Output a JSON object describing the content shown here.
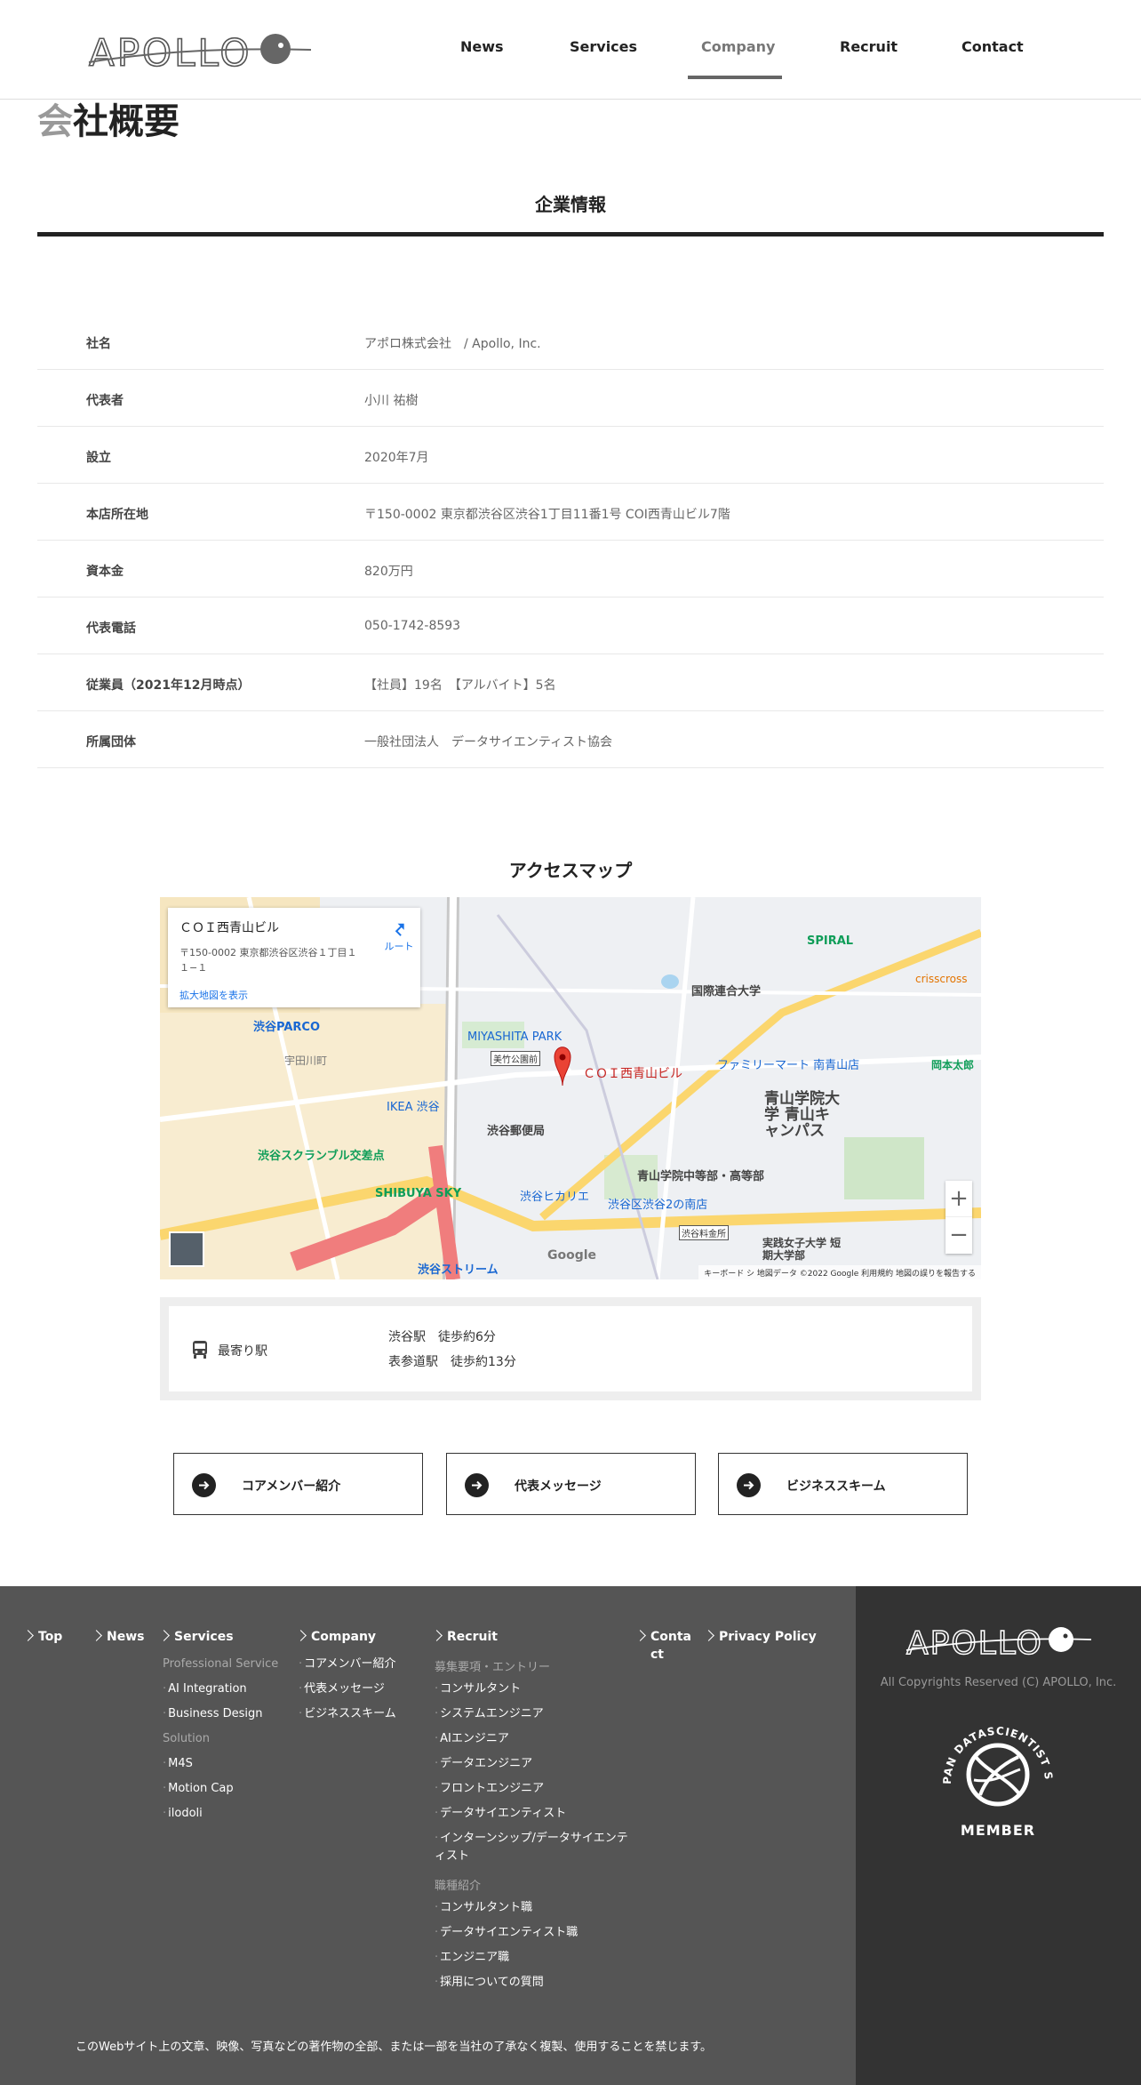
{
  "header": {
    "logo_text": "APOLLO",
    "nav": [
      {
        "label": "News"
      },
      {
        "label": "Services"
      },
      {
        "label": "Company",
        "active": true
      },
      {
        "label": "Recruit"
      },
      {
        "label": "Contact"
      }
    ]
  },
  "page_title": {
    "first_char": "会",
    "rest": "社概要"
  },
  "company_info": {
    "title": "企業情報",
    "rows": [
      {
        "label": "社名",
        "value": "アポロ株式会社　/ Apollo, Inc."
      },
      {
        "label": "代表者",
        "value": "小川 祐樹"
      },
      {
        "label": "設立",
        "value": "2020年7月"
      },
      {
        "label": "本店所在地",
        "value": "〒150-0002 東京都渋谷区渋谷1丁目11番1号 COI西青山ビル7階"
      },
      {
        "label": "資本金",
        "value": "820万円"
      },
      {
        "label": "代表電話",
        "value": "050-1742-8593"
      },
      {
        "label": "従業員（2021年12月時点）",
        "value": "【社員】19名　【アルバイト】5名"
      },
      {
        "label": "所属団体",
        "value": "一般社団法人　データサイエンティスト協会"
      }
    ]
  },
  "access": {
    "title": "アクセスマップ",
    "map": {
      "place_name": "ＣＯＩ西青山ビル",
      "place_address": "〒150-0002 東京都渋谷区渋谷１丁目１１−１",
      "route_label": "ルート",
      "enlarge_label": "拡大地図を表示",
      "pin_label": "ＣＯＩ西青山ビル",
      "zoom_in": "+",
      "zoom_out": "−",
      "google": "Google",
      "footer": "キーボード シ  地図データ ©2022 Google   利用規約   地図の誤りを報告する",
      "labels": [
        {
          "text": "渋谷PARCO",
          "color": "#1967d2"
        },
        {
          "text": "宇田川町",
          "color": "#777"
        },
        {
          "text": "MIYASHITA PARK",
          "color": "#1967d2"
        },
        {
          "text": "美竹公園前",
          "color": "#333"
        },
        {
          "text": "国際連合大学",
          "color": "#444"
        },
        {
          "text": "青山学院大学 青山キャンパス",
          "color": "#444"
        },
        {
          "text": "渋谷スクランブル交差点",
          "color": "#0f9d58"
        },
        {
          "text": "SHIBUYA SKY",
          "color": "#0f9d58"
        },
        {
          "text": "渋谷ヒカリエ",
          "color": "#1967d2"
        },
        {
          "text": "渋谷郵便局",
          "color": "#444"
        },
        {
          "text": "IKEA 渋谷",
          "color": "#1967d2"
        },
        {
          "text": "SPIRAL",
          "color": "#0f9d58"
        },
        {
          "text": "crisscross",
          "color": "#e37400"
        },
        {
          "text": "岡本太郎",
          "color": "#0f9d58"
        },
        {
          "text": "青山学院中等部・高等部",
          "color": "#444"
        },
        {
          "text": "渋谷区渋谷2の南店",
          "color": "#1967d2"
        },
        {
          "text": "渋谷料金所",
          "color": "#333"
        },
        {
          "text": "実践女子大学 短期大学部",
          "color": "#444"
        },
        {
          "text": "渋谷ストリーム",
          "color": "#1967d2"
        },
        {
          "text": "ファミリーマート 南青山店",
          "color": "#1967d2"
        }
      ]
    },
    "station": {
      "label": "最寄り駅",
      "lines": [
        "渋谷駅　徒歩約6分",
        "表参道駅　徒歩約13分"
      ]
    }
  },
  "link_buttons": [
    {
      "label": "コアメンバー紹介"
    },
    {
      "label": "代表メッセージ"
    },
    {
      "label": "ビジネススキーム"
    }
  ],
  "footer": {
    "heads": {
      "top": "Top",
      "news": "News",
      "services": "Services",
      "company": "Company",
      "recruit": "Recruit",
      "contact": "Conta ct",
      "privacy": "Privacy Policy"
    },
    "services": {
      "sub1": "Professional Service",
      "items1": [
        "AI Integration",
        "Business Design"
      ],
      "sub2": "Solution",
      "items2": [
        "M4S",
        "Motion Cap",
        "ilodoli"
      ]
    },
    "company_items": [
      "コアメンバー紹介",
      "代表メッセージ",
      "ビジネススキーム"
    ],
    "recruit": {
      "sub1": "募集要項・エントリー",
      "items1": [
        "コンサルタント",
        "システムエンジニア",
        "AIエンジニア",
        "データエンジニア",
        "フロントエンジニア",
        "データサイエンティスト",
        "インターンシップ/データサイエンティスト"
      ],
      "sub2": "職種紹介",
      "items2": [
        "コンサルタント職",
        "データサイエンティスト職",
        "エンジニア職",
        "採用についての質問"
      ]
    },
    "note": "このWebサイト上の文章、映像、写真などの著作物の全部、または一部を当社の了承なく複製、使用することを禁じます。",
    "copyright": "All Copyrights Reserved (C) APOLLO, Inc.",
    "badge_text_top": "THE JAPAN DATASCIENTIST SOCIETY",
    "badge_text_bottom": "MEMBER"
  }
}
